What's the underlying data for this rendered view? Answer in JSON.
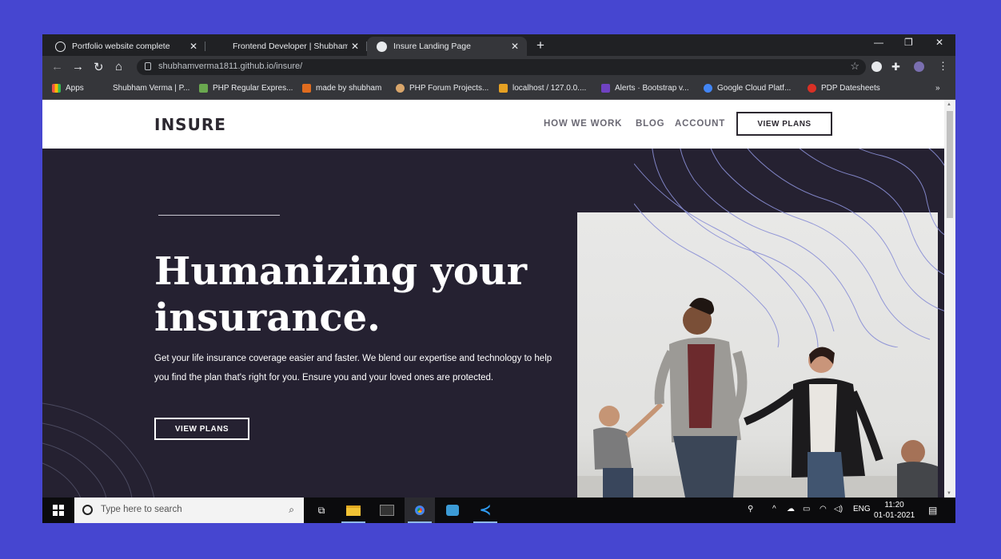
{
  "browser": {
    "tabs": [
      {
        "title": "Portfolio website complete",
        "active": false
      },
      {
        "title": "Frontend Developer | Shubham V",
        "active": false
      },
      {
        "title": "Insure Landing Page",
        "active": true
      }
    ],
    "new_tab": "+",
    "window_controls": {
      "minimize": "—",
      "maximize": "❐",
      "close": "✕"
    },
    "url": "shubhamverma1811.github.io/insure/",
    "bookmarks": [
      {
        "label": "Apps",
        "color": "#e8c22e"
      },
      {
        "label": "Shubham Verma | P...",
        "color": "#333333"
      },
      {
        "label": "PHP Regular Expres...",
        "color": "#6aa84f"
      },
      {
        "label": "made by shubham",
        "color": "#e06c1f"
      },
      {
        "label": "PHP Forum Projects...",
        "color": "#d9a66b"
      },
      {
        "label": "localhost / 127.0.0....",
        "color": "#e6a123"
      },
      {
        "label": "Alerts · Bootstrap v...",
        "color": "#6f42c1"
      },
      {
        "label": "Google Cloud Platf...",
        "color": "#4285f4"
      },
      {
        "label": "PDP Datesheets",
        "color": "#d93025"
      }
    ],
    "more_bookmarks": "»"
  },
  "site": {
    "logo": "INSURE",
    "nav": [
      "HOW WE WORK",
      "BLOG",
      "ACCOUNT"
    ],
    "nav_cta": "VIEW PLANS",
    "hero": {
      "title": "Humanizing your insurance.",
      "description": "Get your life insurance coverage easier and faster. We blend our expertise and technology to help you find the plan that's right for you. Ensure you and your loved ones are protected.",
      "cta": "VIEW PLANS"
    },
    "colors": {
      "dark": "#252131",
      "accent_line": "#8a8fd6",
      "text_gray": "#6a6873"
    }
  },
  "taskbar": {
    "search_placeholder": "Type here to search",
    "language": "ENG",
    "time": "11:20",
    "date": "01-01-2021"
  }
}
